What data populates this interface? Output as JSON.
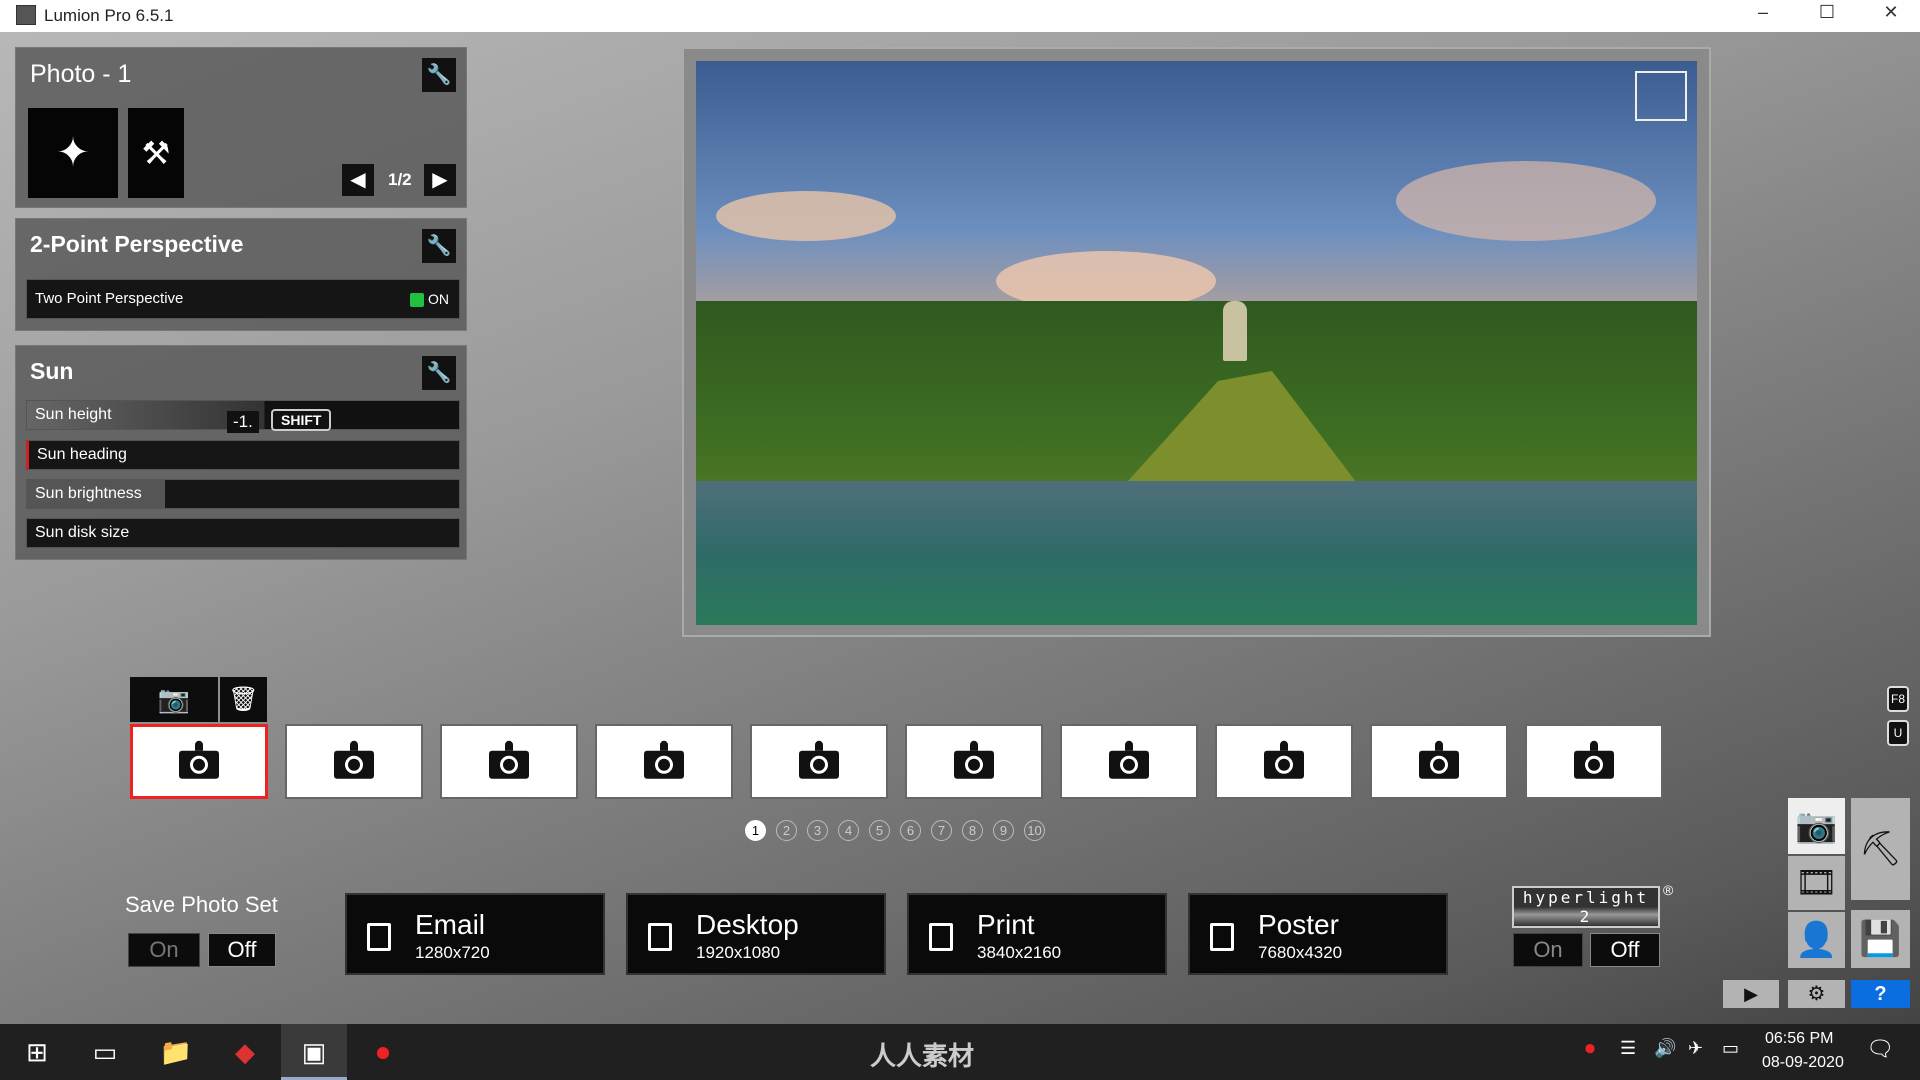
{
  "window": {
    "title": "Lumion Pro 6.5.1",
    "minimize": "–",
    "maximize": "☐",
    "close": "✕"
  },
  "photo_panel": {
    "title": "Photo - 1",
    "page": "1/2",
    "prev": "◀",
    "next": "▶",
    "effects": [
      "add-effect",
      "effect-tool"
    ]
  },
  "perspective_panel": {
    "title": "2-Point Perspective",
    "effect_label": "Two Point Perspective",
    "toggle": "ON",
    "toggle_state": true,
    "toggle_color": "#22c040"
  },
  "sun_panel": {
    "title": "Sun",
    "rows": [
      {
        "label": "Sun height",
        "value": "-1.",
        "key_hint": "SHIFT"
      },
      {
        "label": "Sun heading"
      },
      {
        "label": "Sun brightness"
      },
      {
        "label": "Sun disk size"
      }
    ]
  },
  "photo_slots": {
    "count": 10,
    "selected": 1
  },
  "pages": [
    "1",
    "2",
    "3",
    "4",
    "5",
    "6",
    "7",
    "8",
    "9",
    "10"
  ],
  "active_page": "1",
  "save_photo_set": {
    "label": "Save Photo Set",
    "on": "On",
    "off": "Off"
  },
  "render_options": [
    {
      "name": "Email",
      "size": "1280x720"
    },
    {
      "name": "Desktop",
      "size": "1920x1080"
    },
    {
      "name": "Print",
      "size": "3840x2160"
    },
    {
      "name": "Poster",
      "size": "7680x4320"
    }
  ],
  "hyperlight": {
    "logo": "hyperlight 2",
    "registered": "®",
    "on": "On",
    "off": "Off"
  },
  "shortcuts": {
    "f8": "F8",
    "u": "U"
  },
  "help": "?",
  "help_color": "#0a6ee0",
  "taskbar": {
    "time": "06:56 PM",
    "date": "08-09-2020",
    "center_logo": "人人素材"
  }
}
